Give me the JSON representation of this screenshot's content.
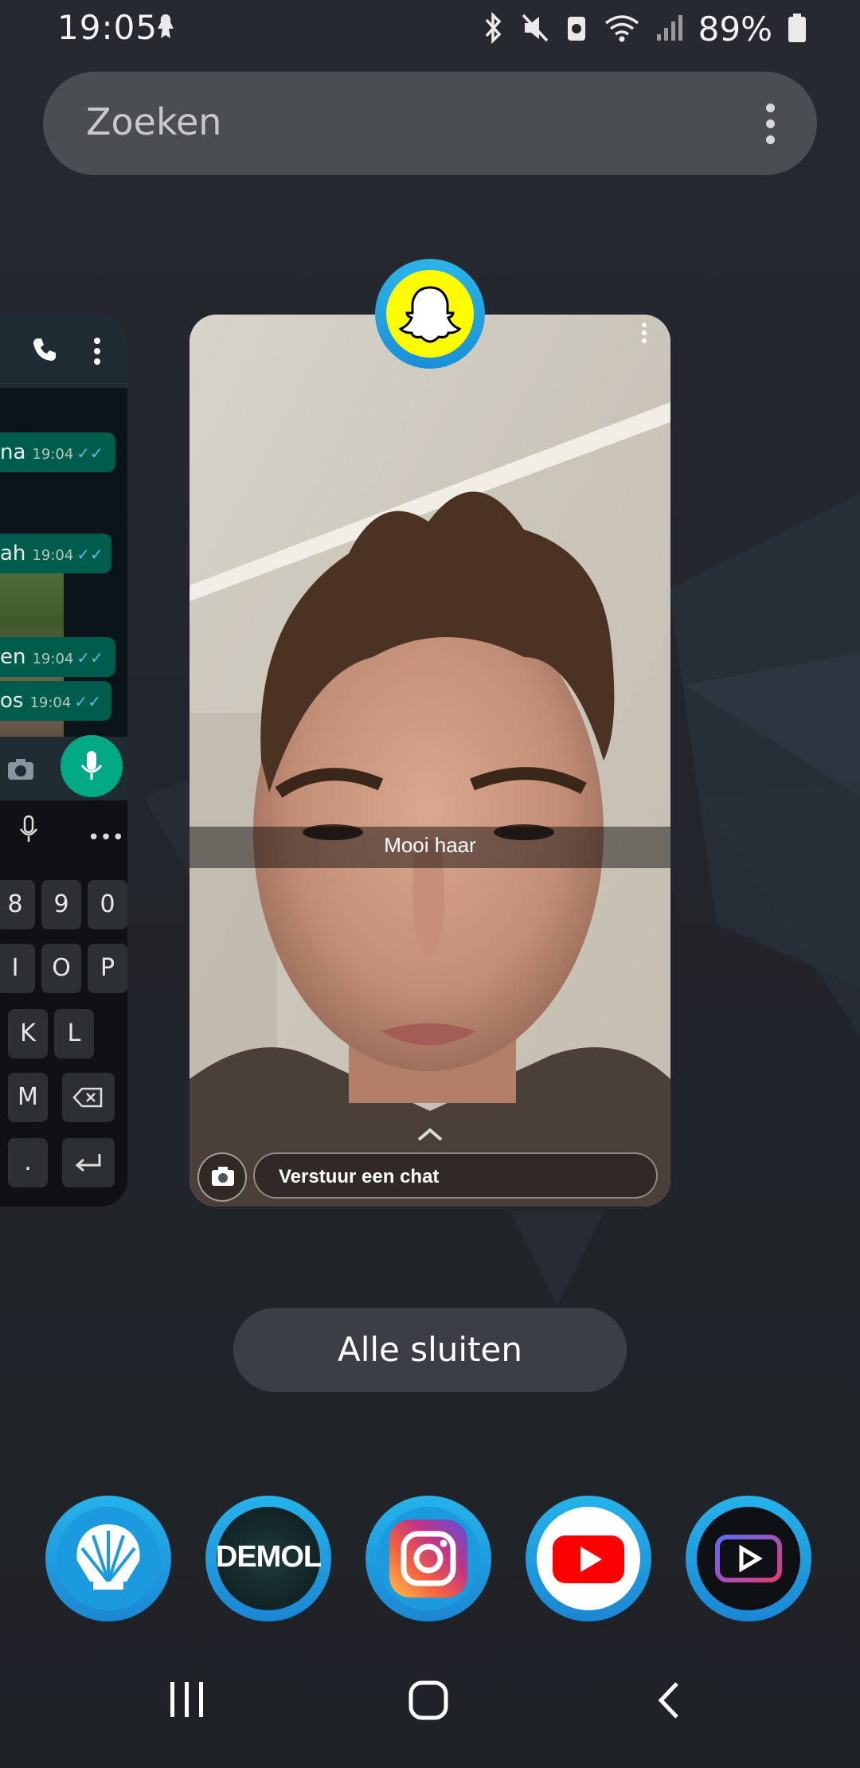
{
  "status_bar": {
    "time": "19:05",
    "battery_percent": "89%",
    "icons": [
      "notification-icon",
      "bluetooth-icon",
      "mute-icon",
      "data-saver-icon",
      "wifi-icon",
      "signal-icon",
      "battery-icon"
    ]
  },
  "search": {
    "placeholder": "Zoeken",
    "menu_icon": "more-vertical-icon"
  },
  "recent_apps": {
    "left_card": {
      "app": "WhatsApp",
      "messages": [
        {
          "text": "na",
          "time": "19:04"
        },
        {
          "text": "ah",
          "time": "19:04"
        },
        {
          "text": "en",
          "time": "19:04"
        },
        {
          "text": "os",
          "time": "19:04"
        }
      ],
      "keyboard": {
        "row1": [
          "8",
          "9",
          "0"
        ],
        "row2": [
          "I",
          "O",
          "P"
        ],
        "row3": [
          "K",
          "L"
        ],
        "row4": [
          "M"
        ],
        "row5": [
          "."
        ]
      }
    },
    "active_card": {
      "app": "Snapchat",
      "caption": "Mooi haar",
      "chat_placeholder": "Verstuur een chat"
    }
  },
  "actions": {
    "close_all": "Alle sluiten"
  },
  "dock": {
    "apps": [
      "Shell",
      "De Mol",
      "Instagram",
      "YouTube",
      "YouTube Vanced"
    ],
    "de_mol_label": "DEMOL",
    "colors": {
      "ring": "#1b9ae0",
      "snapchat_yellow": "#fffc00",
      "youtube_red": "#ff0000",
      "shell": "#ffffff"
    }
  },
  "navigation": {
    "buttons": [
      "recents-button",
      "home-button",
      "back-button"
    ]
  }
}
